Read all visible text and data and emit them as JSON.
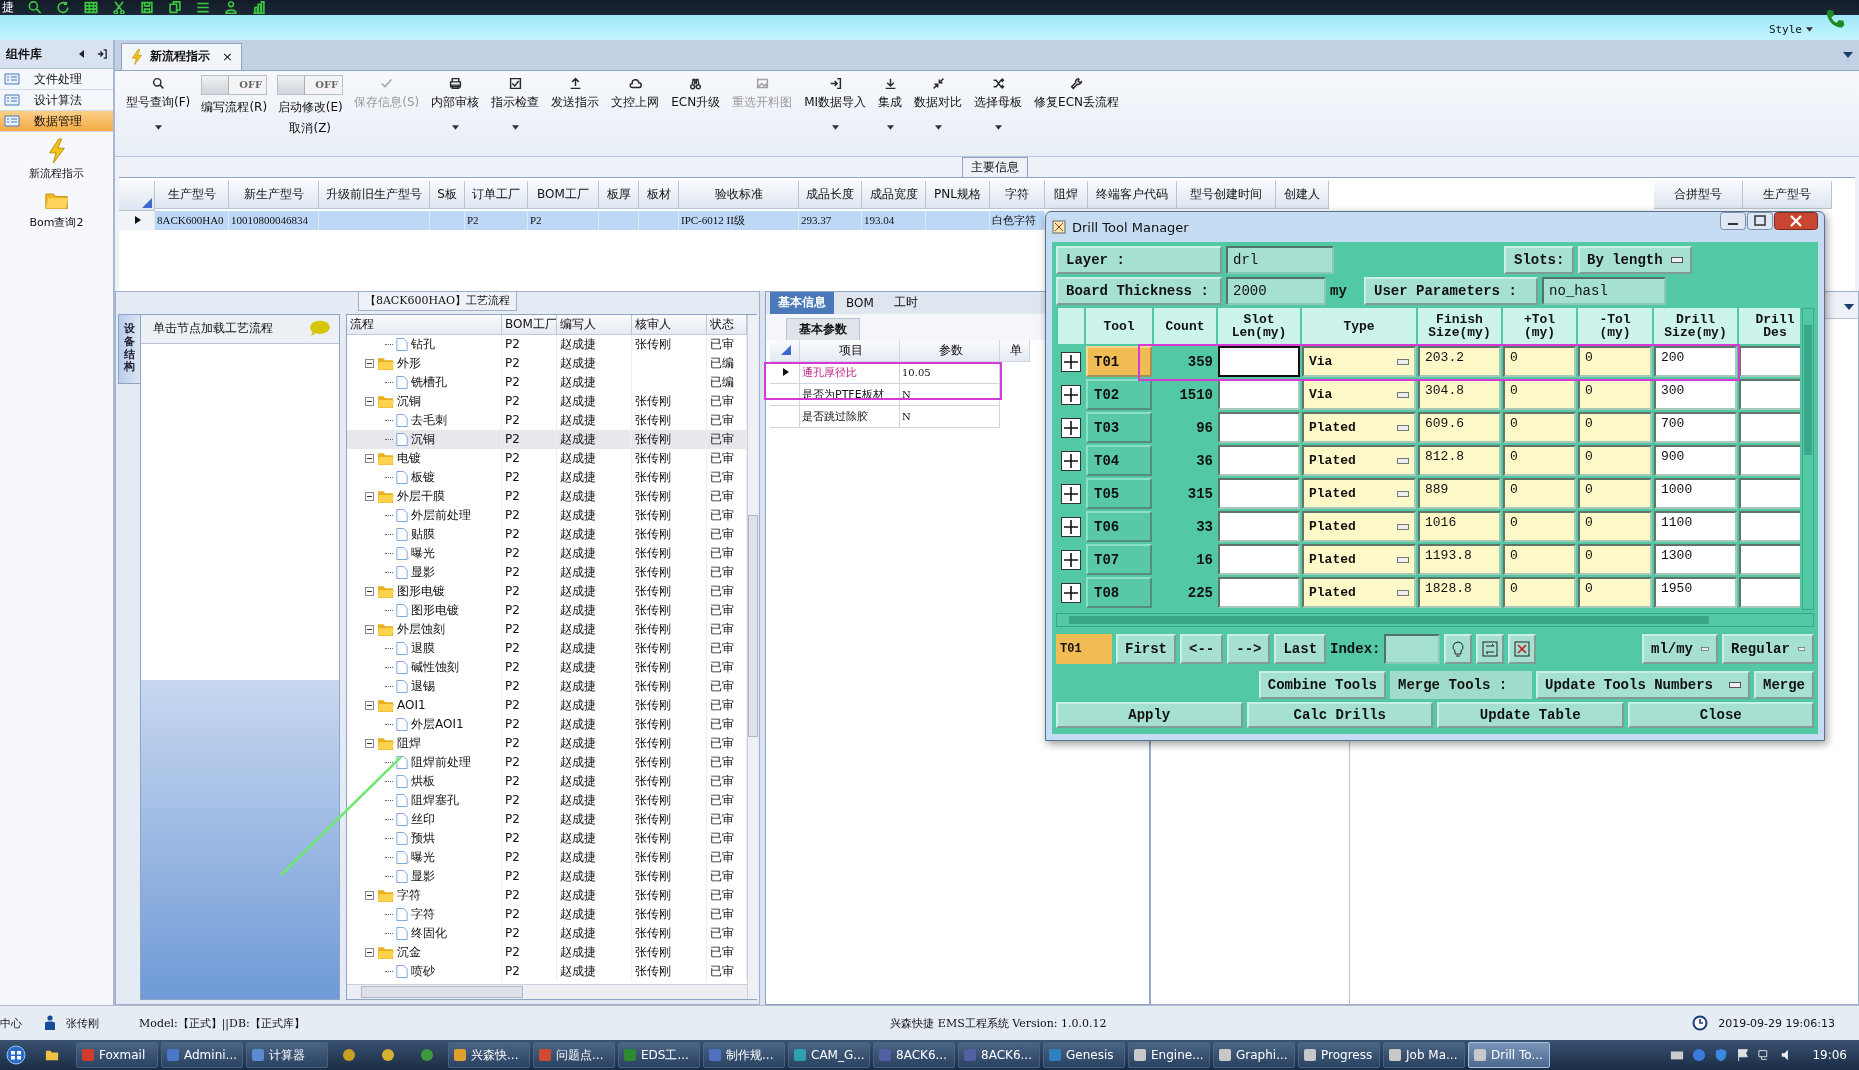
{
  "top_bar": {
    "label": "捷",
    "style_label": "Style"
  },
  "sidebar": {
    "title": "组件库",
    "items": [
      {
        "label": "文件处理",
        "selected": false
      },
      {
        "label": "设计算法",
        "selected": false
      },
      {
        "label": "数据管理",
        "selected": true
      }
    ],
    "shortcuts": [
      "新流程指示",
      "Bom查询2"
    ]
  },
  "document_tab": {
    "title": "新流程指示",
    "close": "×"
  },
  "toolbar": [
    {
      "kind": "button",
      "label": "型号查询(F)",
      "dropdown": true,
      "disabled": false
    },
    {
      "kind": "toggle",
      "label": "编写流程(R)",
      "switch_text": "OFF",
      "on": false
    },
    {
      "kind": "toggle",
      "label": "启动修改(E)",
      "sublabel": "取消(Z)",
      "switch_text": "OFF",
      "on": false
    },
    {
      "kind": "button",
      "label": "保存信息(S)",
      "dropdown": false,
      "disabled": true
    },
    {
      "kind": "button",
      "label": "内部审核",
      "dropdown": true,
      "disabled": false
    },
    {
      "kind": "button",
      "label": "指示检查",
      "dropdown": true,
      "disabled": false
    },
    {
      "kind": "button",
      "label": "发送指示",
      "dropdown": false,
      "disabled": false
    },
    {
      "kind": "button",
      "label": "文控上网",
      "dropdown": false,
      "disabled": false
    },
    {
      "kind": "button",
      "label": "ECN升级",
      "dropdown": false,
      "disabled": false
    },
    {
      "kind": "button",
      "label": "重选开料图",
      "dropdown": false,
      "disabled": true
    },
    {
      "kind": "button",
      "label": "MI数据导入",
      "dropdown": true,
      "disabled": false
    },
    {
      "kind": "button",
      "label": "集成",
      "dropdown": true,
      "disabled": false
    },
    {
      "kind": "button",
      "label": "数据对比",
      "dropdown": true,
      "disabled": false
    },
    {
      "kind": "button",
      "label": "选择母板",
      "dropdown": true,
      "disabled": false
    },
    {
      "kind": "button",
      "label": "修复ECN丢流程",
      "dropdown": false,
      "disabled": false
    }
  ],
  "main_info": {
    "title": "主要信息",
    "columns": [
      "生产型号",
      "新生产型号",
      "升级前旧生产型号",
      "S板",
      "订单工厂",
      "BOM工厂",
      "板厚",
      "板材",
      "验收标准",
      "成品长度",
      "成品宽度",
      "PNL规格",
      "字符",
      "阻焊",
      "终端客户代码",
      "型号创建时间",
      "创建人"
    ],
    "rows": [
      {
        "selected": true,
        "cells": [
          "8ACK600HA0",
          "10010800046834",
          null,
          null,
          "P2",
          "P2",
          null,
          null,
          "IPC-6012 II级",
          "293.37",
          "193.04",
          null,
          "白色字符"
        ]
      }
    ]
  },
  "side_table": {
    "columns": [
      "合拼型号",
      "生产型号"
    ]
  },
  "process": {
    "title": "【8ACK600HAO】工艺流程",
    "side_tab": "设备结构",
    "hint": "单击节点加载工艺流程",
    "columns": [
      "流程",
      "BOM工厂",
      "编写人",
      "核审人",
      "状态"
    ],
    "tree": [
      {
        "children": [
          {
            "label": "钻孔",
            "bom": "P2",
            "writer": "赵成捷",
            "reviewer": "张传刚",
            "status": "已审",
            "selected": false
          }
        ]
      },
      {
        "label": "外形",
        "bom": "P2",
        "writer": "赵成捷",
        "status": "已编",
        "selected": false,
        "expanded": true,
        "children": [
          {
            "label": "铣槽孔",
            "bom": "P2",
            "writer": "赵成捷",
            "status": "已编",
            "selected": false
          }
        ]
      },
      {
        "label": "沉铜",
        "bom": "P2",
        "writer": "赵成捷",
        "reviewer": "张传刚",
        "status": "已审",
        "selected": false,
        "expanded": true,
        "children": [
          {
            "label": "去毛刺",
            "bom": "P2",
            "writer": "赵成捷",
            "reviewer": "张传刚",
            "status": "已审",
            "selected": false
          },
          {
            "label": "沉铜",
            "bom": "P2",
            "writer": "赵成捷",
            "reviewer": "张传刚",
            "status": "已审",
            "selected": true
          }
        ]
      },
      {
        "label": "电镀",
        "bom": "P2",
        "writer": "赵成捷",
        "reviewer": "张传刚",
        "status": "已审",
        "selected": false,
        "expanded": true,
        "children": [
          {
            "label": "板镀",
            "bom": "P2",
            "writer": "赵成捷",
            "reviewer": "张传刚",
            "status": "已审",
            "selected": false
          }
        ]
      },
      {
        "label": "外层干膜",
        "bom": "P2",
        "writer": "赵成捷",
        "reviewer": "张传刚",
        "status": "已审",
        "selected": false,
        "expanded": true,
        "children": [
          {
            "label": "外层前处理",
            "bom": "P2",
            "writer": "赵成捷",
            "reviewer": "张传刚",
            "status": "已审",
            "selected": false
          },
          {
            "label": "贴膜",
            "bom": "P2",
            "writer": "赵成捷",
            "reviewer": "张传刚",
            "status": "已审",
            "selected": false
          },
          {
            "label": "曝光",
            "bom": "P2",
            "writer": "赵成捷",
            "reviewer": "张传刚",
            "status": "已审",
            "selected": false
          },
          {
            "label": "显影",
            "bom": "P2",
            "writer": "赵成捷",
            "reviewer": "张传刚",
            "status": "已审",
            "selected": false
          }
        ]
      },
      {
        "label": "图形电镀",
        "bom": "P2",
        "writer": "赵成捷",
        "reviewer": "张传刚",
        "status": "已审",
        "selected": false,
        "expanded": true,
        "children": [
          {
            "label": "图形电镀",
            "bom": "P2",
            "writer": "赵成捷",
            "reviewer": "张传刚",
            "status": "已审",
            "selected": false
          }
        ]
      },
      {
        "label": "外层蚀刻",
        "bom": "P2",
        "writer": "赵成捷",
        "reviewer": "张传刚",
        "status": "已审",
        "selected": false,
        "expanded": true,
        "children": [
          {
            "label": "退膜",
            "bom": "P2",
            "writer": "赵成捷",
            "reviewer": "张传刚",
            "status": "已审",
            "selected": false
          },
          {
            "label": "碱性蚀刻",
            "bom": "P2",
            "writer": "赵成捷",
            "reviewer": "张传刚",
            "status": "已审",
            "selected": false
          },
          {
            "label": "退锡",
            "bom": "P2",
            "writer": "赵成捷",
            "reviewer": "张传刚",
            "status": "已审",
            "selected": false
          }
        ]
      },
      {
        "label": "AOI1",
        "bom": "P2",
        "writer": "赵成捷",
        "reviewer": "张传刚",
        "status": "已审",
        "selected": false,
        "expanded": true,
        "children": [
          {
            "label": "外层AOI1",
            "bom": "P2",
            "writer": "赵成捷",
            "reviewer": "张传刚",
            "status": "已审",
            "selected": false
          }
        ]
      },
      {
        "label": "阻焊",
        "bom": "P2",
        "writer": "赵成捷",
        "reviewer": "张传刚",
        "status": "已审",
        "selected": false,
        "expanded": true,
        "children": [
          {
            "label": "阻焊前处理",
            "bom": "P2",
            "writer": "赵成捷",
            "reviewer": "张传刚",
            "status": "已审",
            "selected": false
          },
          {
            "label": "烘板",
            "bom": "P2",
            "writer": "赵成捷",
            "reviewer": "张传刚",
            "status": "已审",
            "selected": false
          },
          {
            "label": "阻焊塞孔",
            "bom": "P2",
            "writer": "赵成捷",
            "reviewer": "张传刚",
            "status": "已审",
            "selected": false
          },
          {
            "label": "丝印",
            "bom": "P2",
            "writer": "赵成捷",
            "reviewer": "张传刚",
            "status": "已审",
            "selected": false
          },
          {
            "label": "预烘",
            "bom": "P2",
            "writer": "赵成捷",
            "reviewer": "张传刚",
            "status": "已审",
            "selected": false
          },
          {
            "label": "曝光",
            "bom": "P2",
            "writer": "赵成捷",
            "reviewer": "张传刚",
            "status": "已审",
            "selected": false
          },
          {
            "label": "显影",
            "bom": "P2",
            "writer": "赵成捷",
            "reviewer": "张传刚",
            "status": "已审",
            "selected": false
          }
        ]
      },
      {
        "label": "字符",
        "bom": "P2",
        "writer": "赵成捷",
        "reviewer": "张传刚",
        "status": "已审",
        "selected": false,
        "expanded": true,
        "children": [
          {
            "label": "字符",
            "bom": "P2",
            "writer": "赵成捷",
            "reviewer": "张传刚",
            "status": "已审",
            "selected": false
          },
          {
            "label": "终固化",
            "bom": "P2",
            "writer": "赵成捷",
            "reviewer": "张传刚",
            "status": "已审",
            "selected": false
          }
        ]
      },
      {
        "label": "沉金",
        "bom": "P2",
        "writer": "赵成捷",
        "reviewer": "张传刚",
        "status": "已审",
        "selected": false,
        "expanded": true,
        "children": [
          {
            "label": "喷砂",
            "bom": "P2",
            "writer": "赵成捷",
            "reviewer": "张传刚",
            "status": "已审",
            "selected": false
          }
        ]
      }
    ]
  },
  "info_panel": {
    "tabs": [
      {
        "label": "基本信息",
        "selected": true
      },
      {
        "label": "BOM",
        "selected": false
      },
      {
        "label": "工时",
        "selected": false
      }
    ],
    "subtab": "基本参数",
    "columns": [
      "项目",
      "参数",
      "单"
    ],
    "rows": [
      {
        "name": "通孔厚径比",
        "value": "10.05",
        "selected": true
      },
      {
        "name": "是否为PTFE板材",
        "value": "N",
        "selected": false
      },
      {
        "name": "是否跳过除胶",
        "value": "N",
        "selected": false
      }
    ]
  },
  "drill_dialog": {
    "title": "Drill Tool Manager",
    "layer_label": "Layer :",
    "layer": "drl",
    "slots_label": "Slots:",
    "slots": "By length",
    "thickness_label": "Board Thickness :",
    "thickness": "2000",
    "thickness_unit": "my",
    "user_params_label": "User Parameters :",
    "user_params": "no_hasl",
    "columns": [
      "Tool",
      "Count",
      "Slot Len(my)",
      "Type",
      "Finish Size(my)",
      "+Tol (my)",
      "-Tol (my)",
      "Drill Size(my)",
      "Drill Des"
    ],
    "rows": [
      {
        "tool": "T01",
        "count": "359",
        "type": "Via",
        "finish": "203.2",
        "plus_tol": "0",
        "minus_tol": "0",
        "drill": "200",
        "selected": true
      },
      {
        "tool": "T02",
        "count": "1510",
        "type": "Via",
        "finish": "304.8",
        "plus_tol": "0",
        "minus_tol": "0",
        "drill": "300",
        "selected": false
      },
      {
        "tool": "T03",
        "count": "96",
        "type": "Plated",
        "finish": "609.6",
        "plus_tol": "0",
        "minus_tol": "0",
        "drill": "700",
        "selected": false
      },
      {
        "tool": "T04",
        "count": "36",
        "type": "Plated",
        "finish": "812.8",
        "plus_tol": "0",
        "minus_tol": "0",
        "drill": "900",
        "selected": false
      },
      {
        "tool": "T05",
        "count": "315",
        "type": "Plated",
        "finish": "889",
        "plus_tol": "0",
        "minus_tol": "0",
        "drill": "1000",
        "selected": false
      },
      {
        "tool": "T06",
        "count": "33",
        "type": "Plated",
        "finish": "1016",
        "plus_tol": "0",
        "minus_tol": "0",
        "drill": "1100",
        "selected": false
      },
      {
        "tool": "T07",
        "count": "16",
        "type": "Plated",
        "finish": "1193.8",
        "plus_tol": "0",
        "minus_tol": "0",
        "drill": "1300",
        "selected": false
      },
      {
        "tool": "T08",
        "count": "225",
        "type": "Plated",
        "finish": "1828.8",
        "plus_tol": "0",
        "minus_tol": "0",
        "drill": "1950",
        "selected": false
      }
    ],
    "current_tool": "T01",
    "nav": [
      "First",
      "<--",
      "-->",
      "Last"
    ],
    "index_label": "Index:",
    "units": "ml/my",
    "mode": "Regular",
    "combine": "Combine Tools",
    "merge_label": "Merge Tools :",
    "merge_option": "Update Tools Numbers",
    "merge": "Merge",
    "buttons": [
      "Apply",
      "Calc Drills",
      "Update Table",
      "Close"
    ]
  },
  "status_bar": {
    "left": "中心",
    "user": "张传刚",
    "model": "Model:【正式】||DB:【正式库】",
    "center": "兴森快捷 EMS工程系统 Version: 1.0.0.12",
    "time": "2019-09-29 19:06:13"
  },
  "taskbar": {
    "items": [
      {
        "kind": "app",
        "label": "Foxmail",
        "selected": false
      },
      {
        "kind": "app",
        "label": "Admini...",
        "selected": false
      },
      {
        "kind": "app",
        "label": "计算器",
        "selected": false
      },
      {
        "kind": "icon",
        "selected": false
      },
      {
        "kind": "icon",
        "selected": false
      },
      {
        "kind": "icon",
        "selected": false
      },
      {
        "kind": "app",
        "label": "兴森快...",
        "selected": false
      },
      {
        "kind": "app",
        "label": "问题点...",
        "selected": false
      },
      {
        "kind": "app",
        "label": "EDS工...",
        "selected": false
      },
      {
        "kind": "app",
        "label": "制作规...",
        "selected": false
      },
      {
        "kind": "app",
        "label": "CAM_G...",
        "selected": false
      },
      {
        "kind": "app",
        "label": "8ACK6...",
        "selected": false
      },
      {
        "kind": "app",
        "label": "8ACK6...",
        "selected": false
      },
      {
        "kind": "app",
        "label": "Genesis",
        "selected": false
      },
      {
        "kind": "app",
        "label": "Engine...",
        "selected": false
      },
      {
        "kind": "app",
        "label": "Graphi...",
        "selected": false
      },
      {
        "kind": "app",
        "label": "Progress",
        "selected": false
      },
      {
        "kind": "app",
        "label": "Job Ma...",
        "selected": false
      },
      {
        "kind": "app",
        "label": "Drill To...",
        "selected": true
      }
    ],
    "clock": "19:06"
  }
}
